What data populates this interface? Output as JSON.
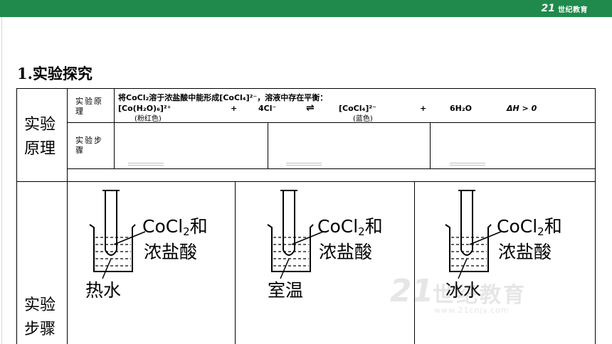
{
  "header": {
    "logo_mark": "21",
    "logo_text": "世纪教育"
  },
  "section_title": "1.实验探究",
  "table": {
    "row1_label": "实验原理",
    "inner": {
      "principle_label": "实验原理",
      "principle_line1": "将CoCl₂溶于浓盐酸中能形成[CoCl₄]²⁻，溶液中存在平衡：",
      "eq_left": "[Co(H₂O)₆]²⁺",
      "eq_plus1": "+",
      "eq_cl": "4Cl⁻",
      "eq_arrow": "⇌",
      "eq_right": "[CoCl₄]²⁻",
      "eq_plus2": "+",
      "eq_water": "6H₂O",
      "eq_dh": "ΔH > 0",
      "color_left": "(粉红色)",
      "color_right": "(蓝色)",
      "steps_label": "实验步骤"
    },
    "row2_label": "实验步骤",
    "setups": [
      {
        "solution_main": "CoCl",
        "solution_sub": "2",
        "solution_tail": "和",
        "solution_line2": "浓盐酸",
        "bath": "热水"
      },
      {
        "solution_main": "CoCl",
        "solution_sub": "2",
        "solution_tail": "和",
        "solution_line2": "浓盐酸",
        "bath": "室温"
      },
      {
        "solution_main": "CoCl",
        "solution_sub": "2",
        "solution_tail": "和",
        "solution_line2": "浓盐酸",
        "bath": "冰水"
      }
    ]
  },
  "watermark": {
    "mark": "21",
    "text": "世纪教育",
    "url": "www.21cnjy.com"
  }
}
